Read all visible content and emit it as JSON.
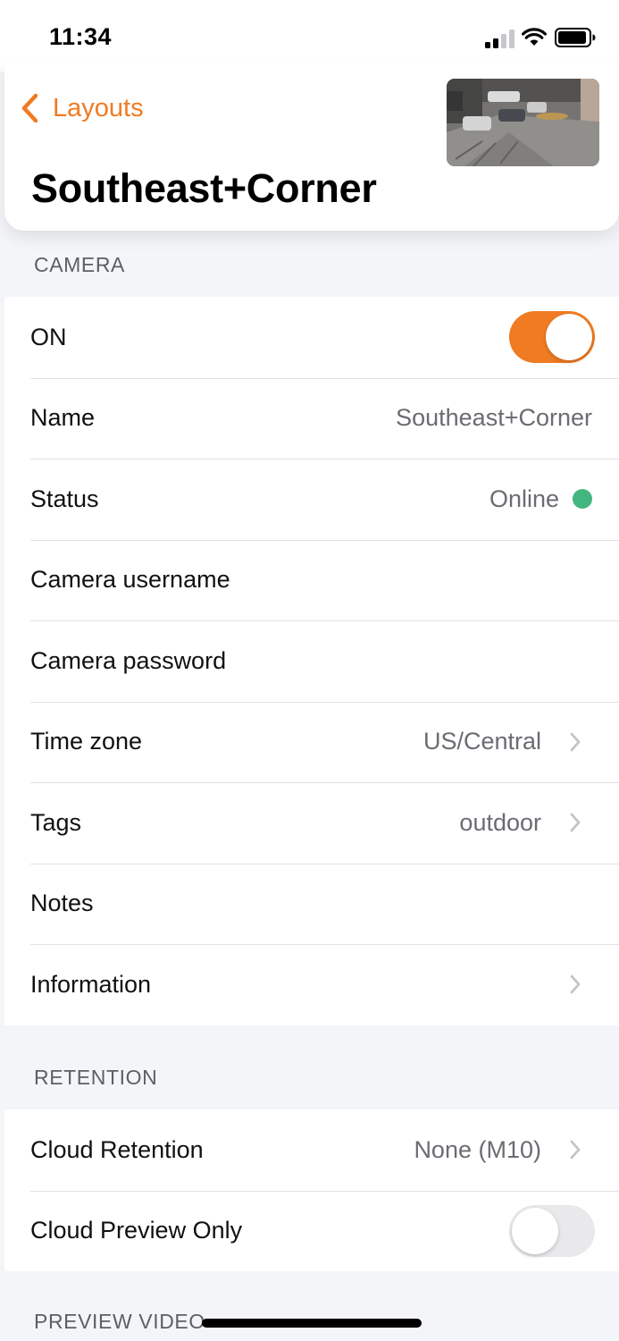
{
  "status_bar": {
    "time": "11:34",
    "signal_icon": "cellular-signal-icon",
    "wifi_icon": "wifi-icon",
    "battery_icon": "battery-icon"
  },
  "header": {
    "back_label": "Layouts",
    "title": "Southeast+Corner",
    "accent_color": "#f07b23"
  },
  "sections": {
    "camera": {
      "title": "CAMERA",
      "on_label": "ON",
      "on_toggle": true,
      "name_label": "Name",
      "name_value": "Southeast+Corner",
      "status_label": "Status",
      "status_value": "Online",
      "status_color": "#43b67f",
      "username_label": "Camera username",
      "password_label": "Camera password",
      "timezone_label": "Time zone",
      "timezone_value": "US/Central",
      "tags_label": "Tags",
      "tags_value": "outdoor",
      "notes_label": "Notes",
      "information_label": "Information"
    },
    "retention": {
      "title": "RETENTION",
      "cloud_retention_label": "Cloud Retention",
      "cloud_retention_value": "None (M10)",
      "cloud_preview_label": "Cloud Preview Only",
      "cloud_preview_toggle": false
    },
    "preview_video": {
      "title": "PREVIEW VIDEO"
    }
  }
}
